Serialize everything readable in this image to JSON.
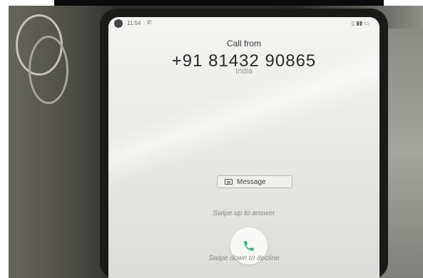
{
  "status_bar": {
    "time": "11:54",
    "call_icon": "phone-call-icon",
    "right_icons": "signal-wifi-battery-icons"
  },
  "incoming_call": {
    "header": "Call from",
    "number": "+91 81432 90865",
    "location": "India"
  },
  "actions": {
    "message_label": "Message",
    "message_icon": "message-icon",
    "swipe_up_label": "Swipe up to answer",
    "answer_icon": "phone-answer-icon",
    "swipe_down_label": "Swipe down to decline"
  },
  "colors": {
    "answer_icon": "#2bb673"
  }
}
